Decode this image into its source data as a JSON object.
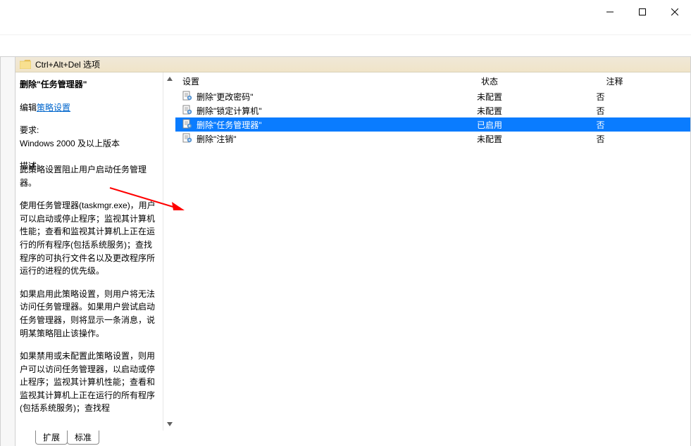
{
  "titlebar": {
    "minimize": "minimize",
    "maximize": "maximize",
    "close": "close"
  },
  "panel": {
    "title": "Ctrl+Alt+Del 选项"
  },
  "description": {
    "policy_title": "删除\"任务管理器\"",
    "edit_prefix": "编辑",
    "edit_link": "策略设置",
    "req_label": "要求:",
    "req_value": "Windows 2000 及以上版本",
    "desc_label": "描述:",
    "desc_text": "此策略设置阻止用户启动任务管理器。",
    "p1": "使用任务管理器(taskmgr.exe)，用户可以启动或停止程序；监视其计算机性能；查看和监视其计算机上正在运行的所有程序(包括系统服务)；查找程序的可执行文件名以及更改程序所运行的进程的优先级。",
    "p2": "如果启用此策略设置，则用户将无法访问任务管理器。如果用户尝试启动任务管理器，则将显示一条消息，说明某策略阻止该操作。",
    "p3": "如果禁用或未配置此策略设置，则用户可以访问任务管理器，以启动或停止程序；监视其计算机性能；查看和监视其计算机上正在运行的所有程序(包括系统服务)；查找程"
  },
  "list": {
    "headers": {
      "setting": "设置",
      "state": "状态",
      "comment": "注释"
    },
    "rows": [
      {
        "name": "删除\"更改密码\"",
        "state": "未配置",
        "comment": "否",
        "selected": false
      },
      {
        "name": "删除\"锁定计算机\"",
        "state": "未配置",
        "comment": "否",
        "selected": false
      },
      {
        "name": "删除\"任务管理器\"",
        "state": "已启用",
        "comment": "否",
        "selected": true
      },
      {
        "name": "删除\"注销\"",
        "state": "未配置",
        "comment": "否",
        "selected": false
      }
    ]
  },
  "tabs": {
    "extended": "扩展",
    "standard": "标准"
  }
}
